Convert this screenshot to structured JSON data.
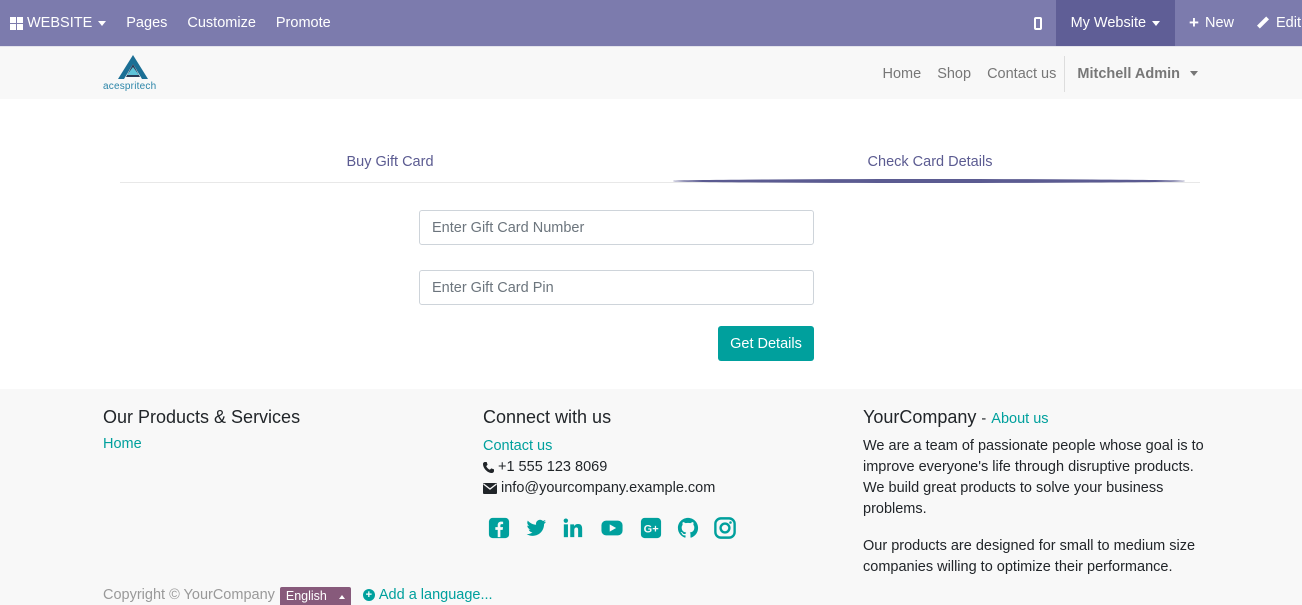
{
  "adminbar": {
    "brand": "WEBSITE",
    "menu": [
      "Pages",
      "Customize",
      "Promote"
    ],
    "my_website": "My Website",
    "new": "New",
    "edit": "Edit",
    "color": "#7c7bad"
  },
  "header": {
    "logo_text": "acespritech",
    "nav": [
      "Home",
      "Shop",
      "Contact us"
    ],
    "user": "Mitchell Admin"
  },
  "tabs": {
    "buy": "Buy Gift Card",
    "check": "Check Card Details",
    "active": "Check Card Details"
  },
  "form": {
    "card_number_placeholder": "Enter Gift Card Number",
    "card_pin_placeholder": "Enter Gift Card Pin",
    "submit": "Get Details",
    "accent": "#00a09d"
  },
  "footer": {
    "products": {
      "title": "Our Products & Services",
      "home": "Home"
    },
    "connect": {
      "title": "Connect with us",
      "contact": "Contact us",
      "phone": "+1 555 123 8069",
      "email": "info@yourcompany.example.com",
      "social": [
        "facebook-icon",
        "twitter-icon",
        "linkedin-icon",
        "youtube-icon",
        "google-plus-icon",
        "github-icon",
        "instagram-icon"
      ]
    },
    "company": {
      "title": "YourCompany",
      "dash": "-",
      "about": "About us",
      "p1": "We are a team of passionate people whose goal is to improve everyone's life through disruptive products. We build great products to solve your business problems.",
      "p2": "Our products are designed for small to medium size companies willing to optimize their performance."
    },
    "copyright": "Copyright © YourCompany",
    "language": "English",
    "add_language": "Add a language..."
  }
}
